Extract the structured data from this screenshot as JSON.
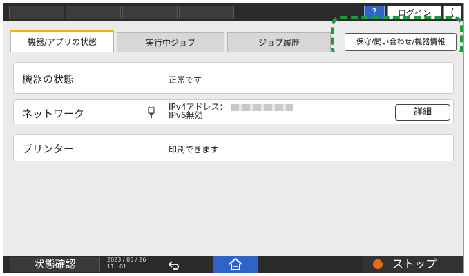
{
  "topbar": {
    "help_label": "?",
    "login_label": "ログイン",
    "moon_label": "(",
    "slot_count_text": ""
  },
  "tabs": [
    {
      "label": "機器/アプリの状態",
      "active": true
    },
    {
      "label": "実行中ジョブ",
      "active": false
    },
    {
      "label": "ジョブ履歴",
      "active": false
    }
  ],
  "maintenance_button": "保守/問い合わせ/機器情報",
  "status_rows": [
    {
      "label": "機器の状態",
      "value": "正常です"
    },
    {
      "label": "ネットワーク",
      "value_line1": "IPv4アドレス：",
      "value_line2": "IPv6無効",
      "detail_button": "詳細"
    },
    {
      "label": "プリンター",
      "value": "印刷できます"
    }
  ],
  "bottombar": {
    "status_label": "状態確認",
    "date": "2023 / 05 / 26",
    "time": "11 : 01",
    "stop_label": "ストップ"
  },
  "colors": {
    "highlight": "#1f9a3a",
    "active_tab_accent": "#f0b400",
    "help_blue": "#2f63c8",
    "home_blue": "#2f63c8",
    "stop_orange": "#e86a1e"
  },
  "icons": {
    "back": "back-arrow-icon",
    "home": "home-icon",
    "stop": "stop-icon",
    "network": "network-plug-icon",
    "moon": "moon-icon"
  }
}
